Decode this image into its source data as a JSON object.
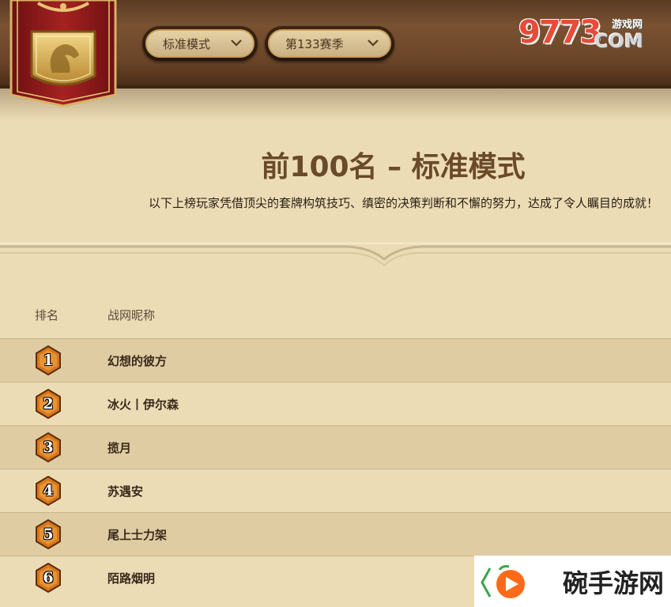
{
  "header": {
    "mode_dropdown": "标准模式",
    "season_dropdown": "第133赛季"
  },
  "watermark_top": {
    "digits": "9773",
    "youxi": "游戏网",
    "com": "COM"
  },
  "page": {
    "title": "前100名 – 标准模式",
    "subtitle": "以下上榜玩家凭借顶尖的套牌构筑技巧、缜密的决策判断和不懈的努力，达成了令人瞩目的成就！"
  },
  "table": {
    "columns": [
      "排名",
      "战网昵称"
    ],
    "rows": [
      {
        "rank": "1",
        "name": "幻想的彼方"
      },
      {
        "rank": "2",
        "name": "冰火丨伊尔森"
      },
      {
        "rank": "3",
        "name": "揽月"
      },
      {
        "rank": "4",
        "name": "苏遇安"
      },
      {
        "rank": "5",
        "name": "尾上士力架"
      },
      {
        "rank": "6",
        "name": "陌路烟明"
      }
    ]
  },
  "watermark_bottom": {
    "text": "碗手游网"
  },
  "colors": {
    "accent": "#c9a05a",
    "banner_red": "#8b1a1a",
    "badge_orange": "#d8761a"
  }
}
